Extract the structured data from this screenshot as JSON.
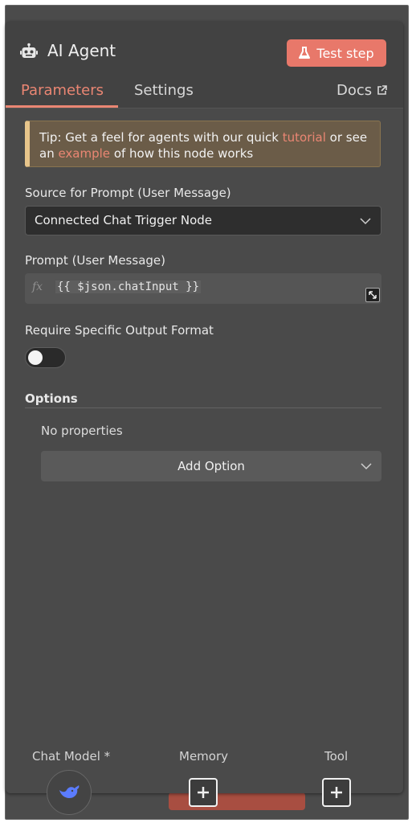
{
  "header": {
    "title": "AI Agent",
    "test_button": "Test step",
    "robot_icon": "robot-icon",
    "flask_icon": "flask-icon"
  },
  "tabs": [
    {
      "label": "Parameters",
      "active": true
    },
    {
      "label": "Settings",
      "active": false
    },
    {
      "label": "Docs",
      "active": false
    }
  ],
  "tip": {
    "before": "Tip: Get a feel for agents with our quick ",
    "link1": "tutorial",
    "middle": " or see an ",
    "link2": "example",
    "after": " of how this node works"
  },
  "source": {
    "label": "Source for Prompt (User Message)",
    "value": "Connected Chat Trigger Node"
  },
  "prompt": {
    "label": "Prompt (User Message)",
    "fx": "fx",
    "expression": "{{ $json.chatInput }}"
  },
  "output_format": {
    "label": "Require Specific Output Format",
    "enabled": false
  },
  "options": {
    "title": "Options",
    "empty_text": "No properties",
    "add_button": "Add Option"
  },
  "connectors": [
    {
      "label": "Chat Model *",
      "icon": "deepseek-whale-icon"
    },
    {
      "label": "Memory",
      "icon": "plus-icon"
    },
    {
      "label": "Tool",
      "icon": "plus-icon"
    }
  ],
  "colors": {
    "accent": "#ea8673",
    "button": "#e8786a",
    "panel": "#424242",
    "tip_bg": "#6b5c48"
  }
}
